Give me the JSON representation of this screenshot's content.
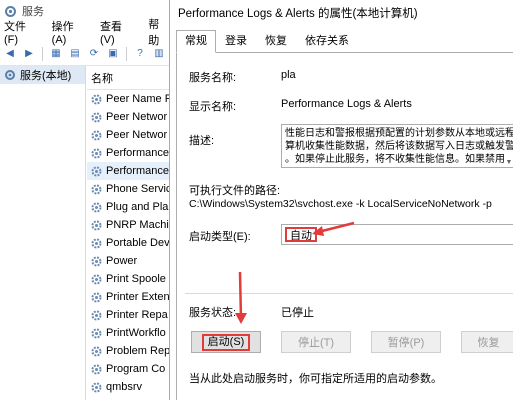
{
  "services_window": {
    "title": "服务",
    "menu": [
      "文件(F)",
      "操作(A)",
      "查看(V)",
      "帮助"
    ],
    "tree_item": "服务(本地)",
    "list_header": "名称",
    "services": [
      "Peer Name Re",
      "Peer Networ",
      "Peer Networ",
      "Performance",
      "Performance",
      "Phone Servic",
      "Plug and Pla",
      "PNRP Machin",
      "Portable Dev",
      "Power",
      "Print Spoole",
      "Printer Exten",
      "Printer Repa",
      "PrintWorkflo",
      "Problem Rep",
      "Program Co",
      "qmbsrv"
    ]
  },
  "dialog": {
    "title": "Performance Logs & Alerts 的属性(本地计算机)",
    "tabs": [
      "常规",
      "登录",
      "恢复",
      "依存关系"
    ],
    "service_name_label": "服务名称:",
    "service_name_value": "pla",
    "display_name_label": "显示名称:",
    "display_name_value": "Performance Logs & Alerts",
    "description_label": "描述:",
    "description_lines": [
      "性能日志和警报根据预配置的计划参数从本地或远程",
      "算机收集性能数据，然后将该数据写入日志或触发警",
      "。如果停止此服务，将不收集性能信息。如果禁用"
    ],
    "exe_path_label": "可执行文件的路径:",
    "exe_path_value": "C:\\Windows\\System32\\svchost.exe -k LocalServiceNoNetwork -p",
    "startup_type_label": "启动类型(E):",
    "startup_type_value": "自动",
    "service_status_label": "服务状态:",
    "service_status_value": "已停止",
    "buttons": {
      "start": "启动(S)",
      "stop": "停止(T)",
      "pause": "暂停(P)",
      "resume": "恢复"
    },
    "hint": "当从此处启动服务时，你可指定所适用的启动参数。"
  },
  "colors": {
    "highlight_red": "#e23b3b",
    "selection_blue": "#e5f0fb"
  }
}
